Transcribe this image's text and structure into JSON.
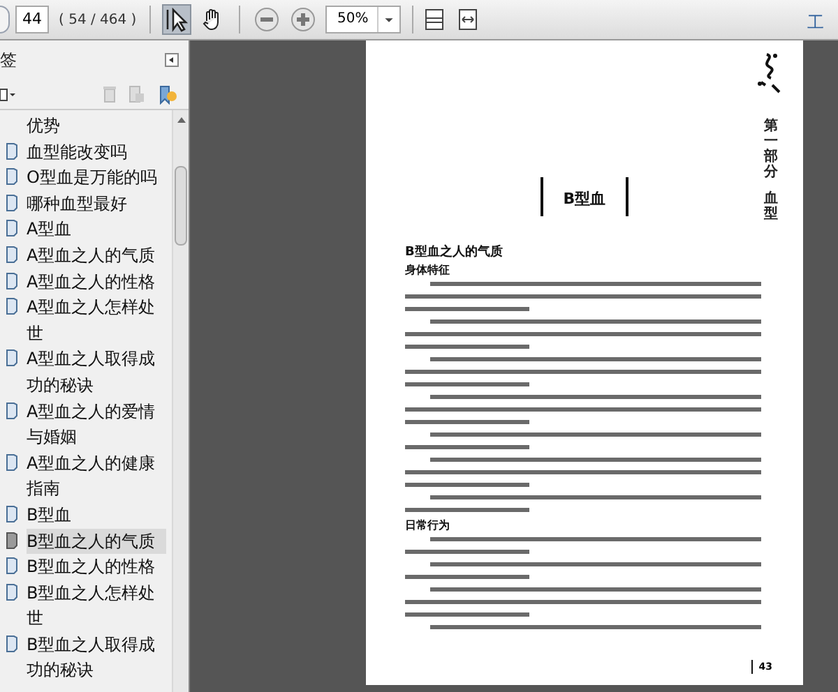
{
  "toolbar": {
    "page_number": "44",
    "page_count": "( 54 / 464 )",
    "tools": [
      {
        "kind": "select",
        "selected": true
      },
      {
        "kind": "hand",
        "selected": false
      }
    ],
    "zoom": "50%",
    "tools_menu": "工"
  },
  "bookmarks_panel": {
    "title": "签",
    "items": [
      {
        "kind": "continuation",
        "label": "优势",
        "selected": false
      },
      {
        "kind": "bookmark",
        "label": "血型能改变吗",
        "selected": false
      },
      {
        "kind": "bookmark",
        "label": "O型血是万能的吗",
        "selected": false
      },
      {
        "kind": "bookmark",
        "label": "哪种血型最好",
        "selected": false
      },
      {
        "kind": "bookmark",
        "label": "A型血",
        "selected": false
      },
      {
        "kind": "bookmark",
        "label": "A型血之人的气质",
        "selected": false
      },
      {
        "kind": "bookmark",
        "label": "A型血之人的性格",
        "selected": false
      },
      {
        "kind": "bookmark",
        "label": "A型血之人怎样处世",
        "selected": false
      },
      {
        "kind": "bookmark",
        "label": "A型血之人取得成功的秘诀",
        "selected": false
      },
      {
        "kind": "bookmark",
        "label": "A型血之人的爱情与婚姻",
        "selected": false
      },
      {
        "kind": "bookmark",
        "label": "A型血之人的健康指南",
        "selected": false
      },
      {
        "kind": "bookmark",
        "label": "B型血",
        "selected": false
      },
      {
        "kind": "bookmark",
        "label": "B型血之人的气质",
        "selected": true
      },
      {
        "kind": "bookmark",
        "label": "B型血之人的性格",
        "selected": false
      },
      {
        "kind": "bookmark",
        "label": "B型血之人怎样处世",
        "selected": false
      },
      {
        "kind": "bookmark",
        "label": "B型血之人取得成功的秘诀",
        "selected": false
      }
    ]
  },
  "document_page": {
    "running_head": [
      "第一部分",
      "血型"
    ],
    "chapter_title": "B型血",
    "section_heading": "B型血之人的气质",
    "blocks": [
      {
        "kind": "subheading",
        "text": "身体特征"
      },
      {
        "kind": "paragraph"
      },
      {
        "kind": "paragraph"
      },
      {
        "kind": "paragraph"
      },
      {
        "kind": "paragraph"
      },
      {
        "kind": "short-paragraph"
      },
      {
        "kind": "paragraph"
      },
      {
        "kind": "short-paragraph"
      },
      {
        "kind": "subheading",
        "text": "日常行为"
      },
      {
        "kind": "short-paragraph"
      },
      {
        "kind": "short-paragraph"
      },
      {
        "kind": "paragraph"
      },
      {
        "kind": "fragment"
      }
    ],
    "page_number": "43"
  }
}
